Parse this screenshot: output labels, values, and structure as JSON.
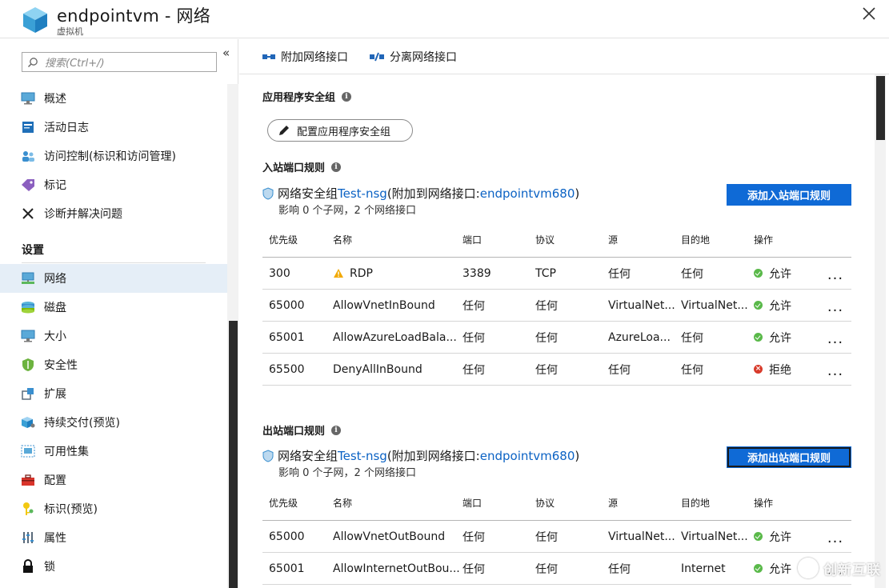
{
  "header": {
    "title": "endpointvm - 网络",
    "subtitle": "虚拟机"
  },
  "sidebar": {
    "search_placeholder": "搜索(Ctrl+/)",
    "collapse_glyph": "«",
    "items": [
      {
        "label": "概述",
        "icon": "monitor-icon"
      },
      {
        "label": "活动日志",
        "icon": "activity-log-icon"
      },
      {
        "label": "访问控制(标识和访问管理)",
        "icon": "people-icon"
      },
      {
        "label": "标记",
        "icon": "tag-icon"
      },
      {
        "label": "诊断并解决问题",
        "icon": "wrench-icon"
      }
    ],
    "section_label": "设置",
    "settings_items": [
      {
        "label": "网络",
        "icon": "network-icon",
        "active": true
      },
      {
        "label": "磁盘",
        "icon": "disk-icon"
      },
      {
        "label": "大小",
        "icon": "monitor-icon"
      },
      {
        "label": "安全性",
        "icon": "shield-icon"
      },
      {
        "label": "扩展",
        "icon": "extensions-icon"
      },
      {
        "label": "持续交付(预览)",
        "icon": "cube-icon"
      },
      {
        "label": "可用性集",
        "icon": "availability-icon"
      },
      {
        "label": "配置",
        "icon": "toolbox-icon"
      },
      {
        "label": "标识(预览)",
        "icon": "key-icon"
      },
      {
        "label": "属性",
        "icon": "properties-icon"
      },
      {
        "label": "锁",
        "icon": "lock-icon"
      }
    ]
  },
  "toolbar": {
    "attach_label": "附加网络接口",
    "detach_label": "分离网络接口"
  },
  "asg": {
    "heading": "应用程序安全组",
    "button_label": "配置应用程序安全组"
  },
  "inbound": {
    "heading": "入站端口规则",
    "nsg_prefix": "网络安全组 ",
    "nsg_name": "Test-nsg",
    "nsg_mid": " (附加到网络接口: ",
    "nic_name": "endpointvm680",
    "nsg_suffix": ")",
    "impact": "影响 0 个子网，2 个网络接口",
    "add_button": "添加入站端口规则",
    "columns": [
      "优先级",
      "名称",
      "端口",
      "协议",
      "源",
      "目的地",
      "操作"
    ],
    "rows": [
      {
        "priority": "300",
        "name": "RDP",
        "warn": true,
        "port": "3389",
        "protocol": "TCP",
        "source": "任何",
        "dest": "任何",
        "action": "允许",
        "allow": true
      },
      {
        "priority": "65000",
        "name": "AllowVnetInBound",
        "warn": false,
        "port": "任何",
        "protocol": "任何",
        "source": "VirtualNet...",
        "dest": "VirtualNet...",
        "action": "允许",
        "allow": true
      },
      {
        "priority": "65001",
        "name": "AllowAzureLoadBala...",
        "warn": false,
        "port": "任何",
        "protocol": "任何",
        "source": "AzureLoa...",
        "dest": "任何",
        "action": "允许",
        "allow": true
      },
      {
        "priority": "65500",
        "name": "DenyAllInBound",
        "warn": false,
        "port": "任何",
        "protocol": "任何",
        "source": "任何",
        "dest": "任何",
        "action": "拒绝",
        "allow": false
      }
    ]
  },
  "outbound": {
    "heading": "出站端口规则",
    "nsg_prefix": "网络安全组 ",
    "nsg_name": "Test-nsg",
    "nsg_mid": " (附加到网络接口: ",
    "nic_name": "endpointvm680",
    "nsg_suffix": ")",
    "impact": "影响 0 个子网，2 个网络接口",
    "add_button": "添加出站端口规则",
    "columns": [
      "优先级",
      "名称",
      "端口",
      "协议",
      "源",
      "目的地",
      "操作"
    ],
    "rows": [
      {
        "priority": "65000",
        "name": "AllowVnetOutBound",
        "warn": false,
        "port": "任何",
        "protocol": "任何",
        "source": "VirtualNet...",
        "dest": "VirtualNet...",
        "action": "允许",
        "allow": true
      },
      {
        "priority": "65001",
        "name": "AllowInternetOutBou...",
        "warn": false,
        "port": "任何",
        "protocol": "任何",
        "source": "任何",
        "dest": "Internet",
        "action": "允许",
        "allow": true
      }
    ]
  },
  "more_glyph": "...",
  "watermark": "创新互联"
}
